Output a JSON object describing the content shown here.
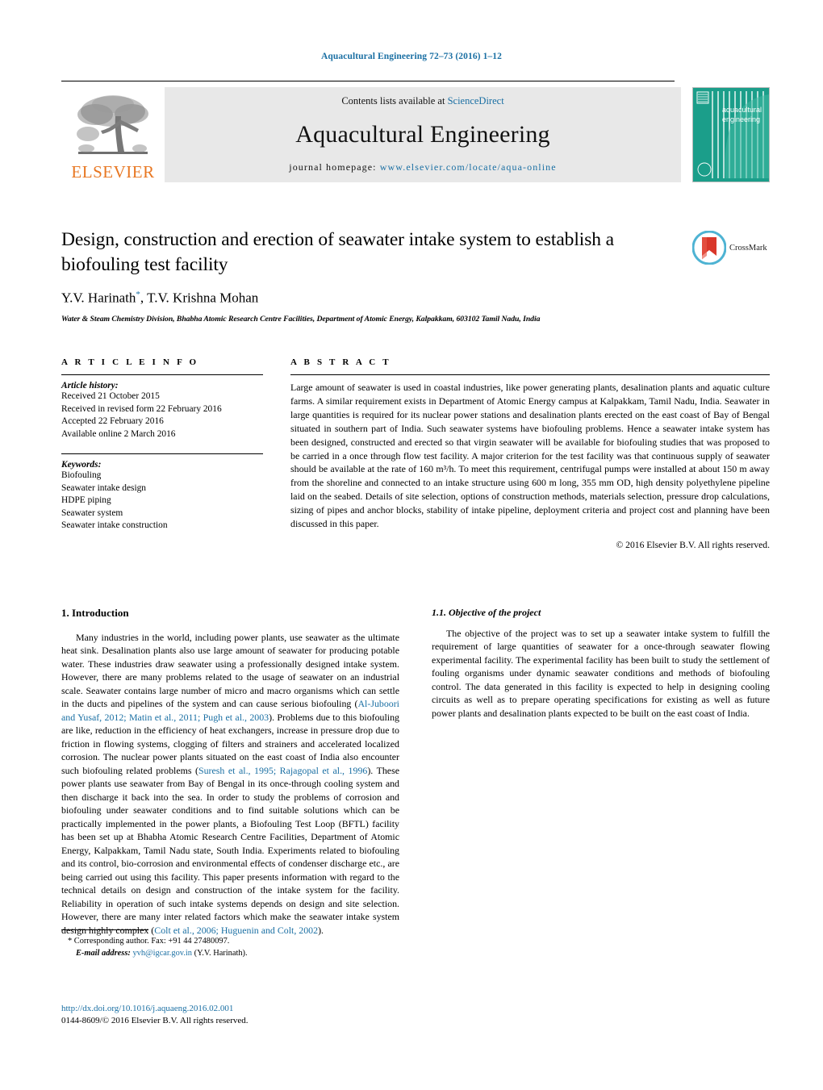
{
  "running_head": "Aquacultural Engineering 72–73 (2016) 1–12",
  "masthead": {
    "contents_prefix": "Contents lists available at ",
    "sciencedirect": "ScienceDirect",
    "journal_title": "Aquacultural Engineering",
    "homepage_prefix": "journal homepage:",
    "homepage_url": "www.elsevier.com/locate/aqua-online",
    "publisher_wordmark": "ELSEVIER",
    "cover_line1": "aquacultural",
    "cover_line2": "engineering"
  },
  "article": {
    "title": "Design, construction and erection of seawater intake system to establish a biofouling test facility",
    "authors_part1": "Y.V. Harinath",
    "authors_star": "*",
    "authors_part2": ", T.V. Krishna Mohan",
    "affiliation": "Water & Steam Chemistry Division, Bhabha Atomic Research Centre Facilities, Department of Atomic Energy, Kalpakkam, 603102 Tamil Nadu, India",
    "crossmark_label": "CrossMark"
  },
  "article_info": {
    "heading": "A R T I C L E   I N F O",
    "history_label": "Article history:",
    "history": [
      "Received 21 October 2015",
      "Received in revised form 22 February 2016",
      "Accepted 22 February 2016",
      "Available online 2 March 2016"
    ],
    "keywords_label": "Keywords:",
    "keywords": [
      "Biofouling",
      "Seawater intake design",
      "HDPE piping",
      "Seawater system",
      "Seawater intake construction"
    ]
  },
  "abstract": {
    "heading": "A B S T R A C T",
    "text": "Large amount of seawater is used in coastal industries, like power generating plants, desalination plants and aquatic culture farms. A similar requirement exists in Department of Atomic Energy campus at Kalpakkam, Tamil Nadu, India. Seawater in large quantities is required for its nuclear power stations and desalination plants erected on the east coast of Bay of Bengal situated in southern part of India. Such seawater systems have biofouling problems. Hence a seawater intake system has been designed, constructed and erected so that virgin seawater will be available for biofouling studies that was proposed to be carried in a once through flow test facility. A major criterion for the test facility was that continuous supply of seawater should be available at the rate of 160 m³/h. To meet this requirement, centrifugal pumps were installed at about 150 m away from the shoreline and connected to an intake structure using 600 m long, 355 mm OD, high density polyethylene pipeline laid on the seabed. Details of site selection, options of construction methods, materials selection, pressure drop calculations, sizing of pipes and anchor blocks, stability of intake pipeline, deployment criteria and project cost and planning have been discussed in this paper.",
    "copyright": "© 2016 Elsevier B.V. All rights reserved."
  },
  "body": {
    "intro_heading": "1.  Introduction",
    "intro_p1_a": "Many industries in the world, including power plants, use seawater as the ultimate heat sink. Desalination plants also use large amount of seawater for producing potable water. These industries draw seawater using a professionally designed intake system. However, there are many problems related to the usage of seawater on an industrial scale. Seawater contains large number of micro and macro organisms which can settle in the ducts and pipelines of the system and can cause serious biofouling (",
    "intro_cite1": "Al-Juboori and Yusaf, 2012; Matin et al., 2011; Pugh et al., 2003",
    "intro_p1_b": "). Problems due to this biofouling are like, reduction in the efficiency of heat exchangers, increase in pressure drop due to friction in flowing systems, clogging of filters and strainers and accelerated localized corrosion. The nuclear power plants situated on the east coast of India also encounter such biofouling related problems (",
    "intro_cite2": "Suresh et al., 1995; Rajagopal et al., 1996",
    "intro_p1_c": "). These power plants use seawater from Bay of Bengal in its once-through cooling system and then discharge it back into the sea. In order to study the problems of corrosion and biofouling under seawater conditions and to find suitable solutions which can be practically implemented in the power plants, a Biofouling Test Loop (BFTL) facility has been set up at Bhabha Atomic Research Centre Facilities, Department of Atomic Energy, Kalpakkam, Tamil Nadu state, South India. Experiments related to biofouling and its control, bio-corrosion and environmental effects of condenser discharge etc., are being carried out using this facility. This paper presents information with regard to the technical details on design and construction of the intake system for the facility. Reliability in operation of such intake systems depends on design and site selection. However, there are many inter related factors which make the seawater intake system design highly complex (",
    "intro_cite3": "Colt et al., 2006; Huguenin and Colt, 2002",
    "intro_p1_d": ").",
    "objective_heading": "1.1.  Objective of the project",
    "objective_text": "The objective of the project was to set up a seawater intake system to fulfill the requirement of large quantities of seawater for a once-through seawater flowing experimental facility. The experimental facility has been built to study the settlement of fouling organisms under dynamic seawater conditions and methods of biofouling control. The data generated in this facility is expected to help in designing cooling circuits as well as to prepare operating specifications for existing as well as future power plants and desalination plants expected to be built on the east coast of India."
  },
  "footer": {
    "corresponding": "*  Corresponding author. Fax: +91 44 27480097.",
    "email_label": "E-mail address:",
    "email": "yvh@igcar.gov.in",
    "email_suffix": "(Y.V. Harinath).",
    "doi": "http://dx.doi.org/10.1016/j.aquaeng.2016.02.001",
    "issn": "0144-8609/© 2016 Elsevier B.V. All rights reserved."
  },
  "colors": {
    "link": "#1a6fa3",
    "elsevier_orange": "#E87722",
    "cover_green": "#1b9e8a"
  }
}
